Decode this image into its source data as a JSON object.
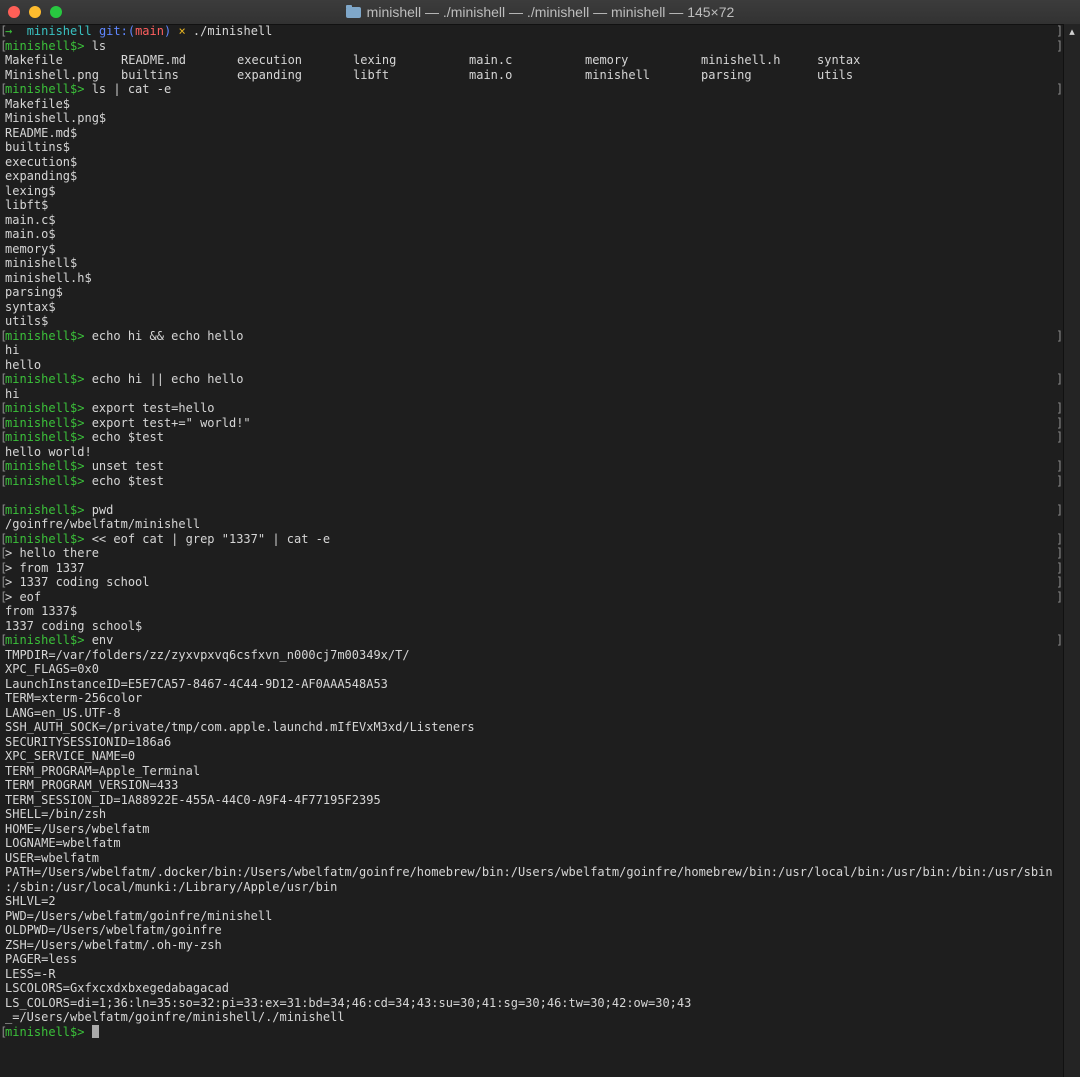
{
  "window": {
    "title": "minishell — ./minishell — ./minishell — minishell — 145×72"
  },
  "terminal": {
    "shell_arrow": "→",
    "shell_dir": "minishell",
    "git_label": "git:(",
    "git_branch": "main",
    "git_close": ")",
    "dirty_mark": "×",
    "launch_cmd": "./minishell",
    "prompt": "minishell$>",
    "ls_cmd": "ls",
    "ls_row1": [
      "Makefile",
      "README.md",
      "execution",
      "lexing",
      "main.c",
      "memory",
      "minishell.h",
      "syntax"
    ],
    "ls_row2": [
      "Minishell.png",
      "builtins",
      "expanding",
      "libft",
      "main.o",
      "minishell",
      "parsing",
      "utils"
    ],
    "cat_cmd": "ls | cat -e",
    "cat_output": [
      "Makefile$",
      "Minishell.png$",
      "README.md$",
      "builtins$",
      "execution$",
      "expanding$",
      "lexing$",
      "libft$",
      "main.c$",
      "main.o$",
      "memory$",
      "minishell$",
      "minishell.h$",
      "parsing$",
      "syntax$",
      "utils$"
    ],
    "and_cmd": "echo hi && echo hello",
    "and_output": [
      "hi",
      "hello"
    ],
    "or_cmd": "echo hi || echo hello",
    "or_output": [
      "hi"
    ],
    "export1_cmd": "export test=hello",
    "export2_cmd": "export test+=\" world!\"",
    "echo_test_cmd": "echo $test",
    "echo_test_output": "hello world!",
    "unset_cmd": "unset test",
    "echo_test2_cmd": "echo $test",
    "pwd_cmd": "pwd",
    "pwd_output": "/goinfre/wbelfatm/minishell",
    "heredoc_cmd": "<< eof cat | grep \"1337\" | cat -e",
    "heredoc_lines": [
      "> hello there",
      "> from 1337",
      "> 1337 coding school",
      "> eof"
    ],
    "heredoc_output": [
      "from 1337$",
      "1337 coding school$"
    ],
    "env_cmd": "env",
    "env_output": [
      "TMPDIR=/var/folders/zz/zyxvpxvq6csfxvn_n000cj7m00349x/T/",
      "XPC_FLAGS=0x0",
      "LaunchInstanceID=E5E7CA57-8467-4C44-9D12-AF0AAA548A53",
      "TERM=xterm-256color",
      "LANG=en_US.UTF-8",
      "SSH_AUTH_SOCK=/private/tmp/com.apple.launchd.mIfEVxM3xd/Listeners",
      "SECURITYSESSIONID=186a6",
      "XPC_SERVICE_NAME=0",
      "TERM_PROGRAM=Apple_Terminal",
      "TERM_PROGRAM_VERSION=433",
      "TERM_SESSION_ID=1A88922E-455A-44C0-A9F4-4F77195F2395",
      "SHELL=/bin/zsh",
      "HOME=/Users/wbelfatm",
      "LOGNAME=wbelfatm",
      "USER=wbelfatm",
      "PATH=/Users/wbelfatm/.docker/bin:/Users/wbelfatm/goinfre/homebrew/bin:/Users/wbelfatm/goinfre/homebrew/bin:/usr/local/bin:/usr/bin:/bin:/usr/sbin",
      ":/sbin:/usr/local/munki:/Library/Apple/usr/bin",
      "SHLVL=2",
      "PWD=/Users/wbelfatm/goinfre/minishell",
      "OLDPWD=/Users/wbelfatm/goinfre",
      "ZSH=/Users/wbelfatm/.oh-my-zsh",
      "PAGER=less",
      "LESS=-R",
      "LSCOLORS=Gxfxcxdxbxegedabagacad",
      "LS_COLORS=di=1;36:ln=35:so=32:pi=33:ex=31:bd=34;46:cd=34;43:su=30;41:sg=30;46:tw=30;42:ow=30;43",
      "_=/Users/wbelfatm/goinfre/minishell/./minishell"
    ]
  },
  "colors": {
    "prompt": "#3bc13a",
    "background": "#1e1e1e",
    "text": "#d6d6d6"
  },
  "icons": [
    "folder-icon",
    "scroll-up-arrow-icon",
    "cursor-block-icon"
  ]
}
